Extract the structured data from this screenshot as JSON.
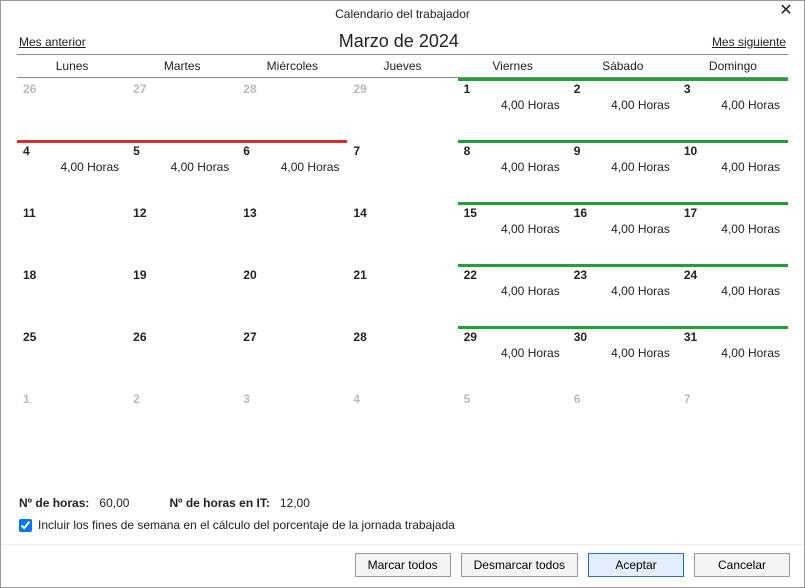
{
  "window": {
    "title": "Calendario del trabajador"
  },
  "nav": {
    "prev": "Mes anterior",
    "next": "Mes siguiente",
    "month": "Marzo de 2024"
  },
  "daynames": [
    "Lunes",
    "Martes",
    "Miércoles",
    "Jueves",
    "Viernes",
    "Sábado",
    "Domingo"
  ],
  "labels": {
    "hours_unit": "Horas"
  },
  "cells": [
    {
      "n": "26",
      "faded": true,
      "bar": "",
      "hours": ""
    },
    {
      "n": "27",
      "faded": true,
      "bar": "",
      "hours": ""
    },
    {
      "n": "28",
      "faded": true,
      "bar": "",
      "hours": ""
    },
    {
      "n": "29",
      "faded": true,
      "bar": "",
      "hours": ""
    },
    {
      "n": "1",
      "faded": false,
      "bar": "green",
      "hours": "4,00 Horas"
    },
    {
      "n": "2",
      "faded": false,
      "bar": "green",
      "hours": "4,00 Horas"
    },
    {
      "n": "3",
      "faded": false,
      "bar": "green",
      "hours": "4,00 Horas"
    },
    {
      "n": "4",
      "faded": false,
      "bar": "red",
      "hours": "4,00 Horas"
    },
    {
      "n": "5",
      "faded": false,
      "bar": "red",
      "hours": "4,00 Horas"
    },
    {
      "n": "6",
      "faded": false,
      "bar": "red",
      "hours": "4,00 Horas"
    },
    {
      "n": "7",
      "faded": false,
      "bar": "",
      "hours": ""
    },
    {
      "n": "8",
      "faded": false,
      "bar": "green",
      "hours": "4,00 Horas"
    },
    {
      "n": "9",
      "faded": false,
      "bar": "green",
      "hours": "4,00 Horas"
    },
    {
      "n": "10",
      "faded": false,
      "bar": "green",
      "hours": "4,00 Horas"
    },
    {
      "n": "11",
      "faded": false,
      "bar": "",
      "hours": ""
    },
    {
      "n": "12",
      "faded": false,
      "bar": "",
      "hours": ""
    },
    {
      "n": "13",
      "faded": false,
      "bar": "",
      "hours": ""
    },
    {
      "n": "14",
      "faded": false,
      "bar": "",
      "hours": ""
    },
    {
      "n": "15",
      "faded": false,
      "bar": "green",
      "hours": "4,00 Horas"
    },
    {
      "n": "16",
      "faded": false,
      "bar": "green",
      "hours": "4,00 Horas"
    },
    {
      "n": "17",
      "faded": false,
      "bar": "green",
      "hours": "4,00 Horas"
    },
    {
      "n": "18",
      "faded": false,
      "bar": "",
      "hours": ""
    },
    {
      "n": "19",
      "faded": false,
      "bar": "",
      "hours": ""
    },
    {
      "n": "20",
      "faded": false,
      "bar": "",
      "hours": ""
    },
    {
      "n": "21",
      "faded": false,
      "bar": "",
      "hours": ""
    },
    {
      "n": "22",
      "faded": false,
      "bar": "green",
      "hours": "4,00 Horas"
    },
    {
      "n": "23",
      "faded": false,
      "bar": "green",
      "hours": "4,00 Horas"
    },
    {
      "n": "24",
      "faded": false,
      "bar": "green",
      "hours": "4,00 Horas"
    },
    {
      "n": "25",
      "faded": false,
      "bar": "",
      "hours": ""
    },
    {
      "n": "26",
      "faded": false,
      "bar": "",
      "hours": ""
    },
    {
      "n": "27",
      "faded": false,
      "bar": "",
      "hours": ""
    },
    {
      "n": "28",
      "faded": false,
      "bar": "",
      "hours": ""
    },
    {
      "n": "29",
      "faded": false,
      "bar": "green",
      "hours": "4,00 Horas"
    },
    {
      "n": "30",
      "faded": false,
      "bar": "green",
      "hours": "4,00 Horas"
    },
    {
      "n": "31",
      "faded": false,
      "bar": "green",
      "hours": "4,00 Horas"
    },
    {
      "n": "1",
      "faded": true,
      "bar": "",
      "hours": ""
    },
    {
      "n": "2",
      "faded": true,
      "bar": "",
      "hours": ""
    },
    {
      "n": "3",
      "faded": true,
      "bar": "",
      "hours": ""
    },
    {
      "n": "4",
      "faded": true,
      "bar": "",
      "hours": ""
    },
    {
      "n": "5",
      "faded": true,
      "bar": "",
      "hours": ""
    },
    {
      "n": "6",
      "faded": true,
      "bar": "",
      "hours": ""
    },
    {
      "n": "7",
      "faded": true,
      "bar": "",
      "hours": ""
    }
  ],
  "totals": {
    "hours_label": "Nº de horas:",
    "hours_value": "60,00",
    "it_label": "Nº de horas en IT:",
    "it_value": "12,00"
  },
  "checkbox": {
    "checked": true,
    "label": "Incluir los fines de semana en el cálculo del porcentaje de la jornada trabajada"
  },
  "buttons": {
    "mark_all": "Marcar todos",
    "unmark_all": "Desmarcar todos",
    "ok": "Aceptar",
    "cancel": "Cancelar"
  }
}
